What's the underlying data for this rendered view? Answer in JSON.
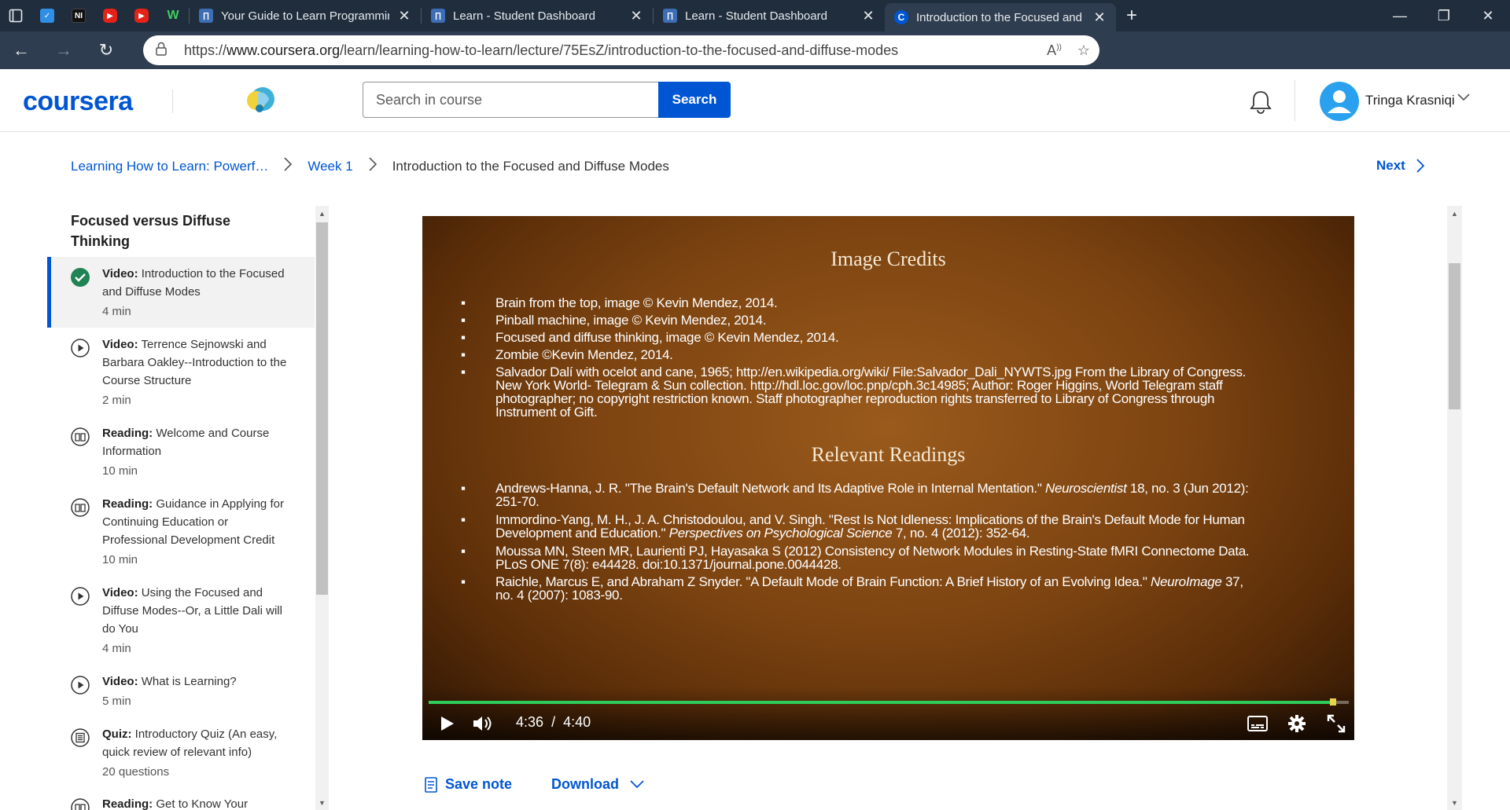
{
  "browser": {
    "tabs": [
      {
        "title": "Your Guide to Learn Programmin",
        "active": false
      },
      {
        "title": "Learn - Student Dashboard",
        "active": false
      },
      {
        "title": "Learn - Student Dashboard",
        "active": false
      },
      {
        "title": "Introduction to the Focused and",
        "active": true
      }
    ],
    "url_prefix": "https://",
    "url_host": "www.coursera.org",
    "url_path": "/learn/learning-how-to-learn/lecture/75EsZ/introduction-to-the-focused-and-diffuse-modes",
    "pinned_icons": [
      "todo-icon",
      "ni-icon",
      "youtube-icon",
      "youtube-icon",
      "w-icon"
    ],
    "colors": {
      "chrome_dark": "#1f2d3d",
      "chrome": "#2e3e50"
    }
  },
  "header": {
    "logo": "coursera",
    "search_placeholder": "Search in course",
    "search_button": "Search",
    "user_name": "Tringa Krasniqi",
    "brand_color": "#0056d2"
  },
  "breadcrumb": {
    "course": "Learning How to Learn: Powerf…",
    "week": "Week 1",
    "current": "Introduction to the Focused and Diffuse Modes",
    "next": "Next"
  },
  "sidebar": {
    "section_title": "Focused versus Diffuse Thinking",
    "items": [
      {
        "type": "Video:",
        "title": "Introduction to the Focused and Diffuse Modes",
        "meta": "4 min",
        "icon": "check-circle-icon",
        "active": true
      },
      {
        "type": "Video:",
        "title": "Terrence Sejnowski and Barbara Oakley--Introduction to the Course Structure",
        "meta": "2 min",
        "icon": "play-circle-icon",
        "active": false
      },
      {
        "type": "Reading:",
        "title": "Welcome and Course Information",
        "meta": "10 min",
        "icon": "book-icon",
        "active": false
      },
      {
        "type": "Reading:",
        "title": "Guidance in Applying for Continuing Education or Professional Development Credit",
        "meta": "10 min",
        "icon": "book-icon",
        "active": false
      },
      {
        "type": "Video:",
        "title": "Using the Focused and Diffuse Modes--Or, a Little Dali will do You",
        "meta": "4 min",
        "icon": "play-circle-icon",
        "active": false
      },
      {
        "type": "Video:",
        "title": "What is Learning?",
        "meta": "5 min",
        "icon": "play-circle-icon",
        "active": false
      },
      {
        "type": "Quiz:",
        "title": "Introductory Quiz (An easy, quick review of relevant info)",
        "meta": "20 questions",
        "icon": "quiz-icon",
        "active": false
      },
      {
        "type": "Reading:",
        "title": "Get to Know Your",
        "meta": "",
        "icon": "book-icon",
        "active": false
      }
    ]
  },
  "video": {
    "slide": {
      "heading1": "Image Credits",
      "credits": [
        "Brain from the top, image © Kevin Mendez, 2014.",
        "Pinball machine, image © Kevin Mendez, 2014.",
        "Focused and diffuse thinking, image © Kevin Mendez, 2014.",
        "Zombie ©Kevin Mendez, 2014.",
        "Salvador Dalí with ocelot and cane, 1965; http://en.wikipedia.org/wiki/ File:Salvador_Dali_NYWTS.jpg From the Library of Congress. New York World- Telegram & Sun collection. http://hdl.loc.gov/loc.pnp/cph.3c14985; Author: Roger Higgins, World Telegram staff photographer; no copyright restriction known. Staff photographer reproduction rights transferred to Library of Congress through Instrument of Gift."
      ],
      "heading2": "Relevant Readings",
      "readings": [
        {
          "pre": "Andrews-Hanna, J. R. \"The Brain's Default Network and Its Adaptive Role in Internal Mentation.\" ",
          "ital": "Neuroscientist",
          "post": " 18, no. 3 (Jun 2012): 251-70."
        },
        {
          "pre": "Immordino-Yang, M. H., J. A. Christodoulou, and V. Singh. \"Rest Is Not Idleness: Implications of the Brain's Default Mode for Human Development and Education.\" ",
          "ital": "Perspectives on Psychological Science",
          "post": " 7, no. 4 (2012): 352-64."
        },
        {
          "pre": "Moussa MN, Steen MR, Laurienti PJ, Hayasaka S (2012) Consistency of Network Modules in Resting-State fMRI Connectome Data. PLoS ONE 7(8): e44428. doi:10.1371/journal.pone.0044428.",
          "ital": "",
          "post": ""
        },
        {
          "pre": "Raichle, Marcus E, and Abraham Z Snyder. \"A Default Mode of Brain Function: A Brief History of an Evolving Idea.\" ",
          "ital": "NeuroImage",
          "post": " 37, no. 4 (2007): 1083-90."
        }
      ]
    },
    "current_time": "4:36",
    "time_separator": "/",
    "duration": "4:40",
    "progress_fraction": 0.983,
    "progress_color": "#2ecc5a"
  },
  "actions": {
    "save_note": "Save note",
    "download": "Download"
  }
}
